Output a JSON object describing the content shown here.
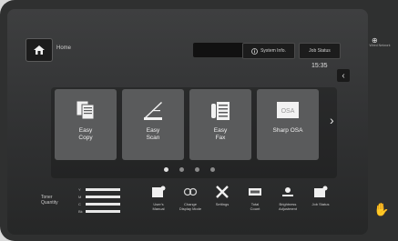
{
  "header": {
    "home_label": "Home",
    "system_info_label": "System Info.",
    "job_status_label": "Job Status",
    "clock": "15:35"
  },
  "apps": [
    {
      "label_line1": "Easy",
      "label_line2": "Copy",
      "icon": "copy-icon",
      "color": "#f2f2f2"
    },
    {
      "label_line1": "Easy",
      "label_line2": "Scan",
      "icon": "scan-icon",
      "color": "#f2f2f2"
    },
    {
      "label_line1": "Easy",
      "label_line2": "Fax",
      "icon": "fax-icon",
      "color": "#f2f2f2"
    },
    {
      "label_line1": "Sharp OSA",
      "label_line2": "",
      "icon": "osa-icon",
      "color": "#f2f2f2"
    }
  ],
  "pager": {
    "pages": 4,
    "current": 1
  },
  "toner": {
    "label_line1": "Toner",
    "label_line2": "Quantity",
    "rows": [
      "Y",
      "M",
      "C",
      "Bk"
    ]
  },
  "functions": [
    {
      "label_line1": "User's",
      "label_line2": "Manual"
    },
    {
      "label_line1": "Change",
      "label_line2": "Display Mode"
    },
    {
      "label_line1": "Settings",
      "label_line2": ""
    },
    {
      "label_line1": "Total",
      "label_line2": "Count"
    },
    {
      "label_line1": "Brightness",
      "label_line2": "Adjustment"
    },
    {
      "label_line1": "Job Status",
      "label_line2": ""
    }
  ],
  "side": {
    "icon": "network-icon",
    "label": "Wired Network"
  }
}
